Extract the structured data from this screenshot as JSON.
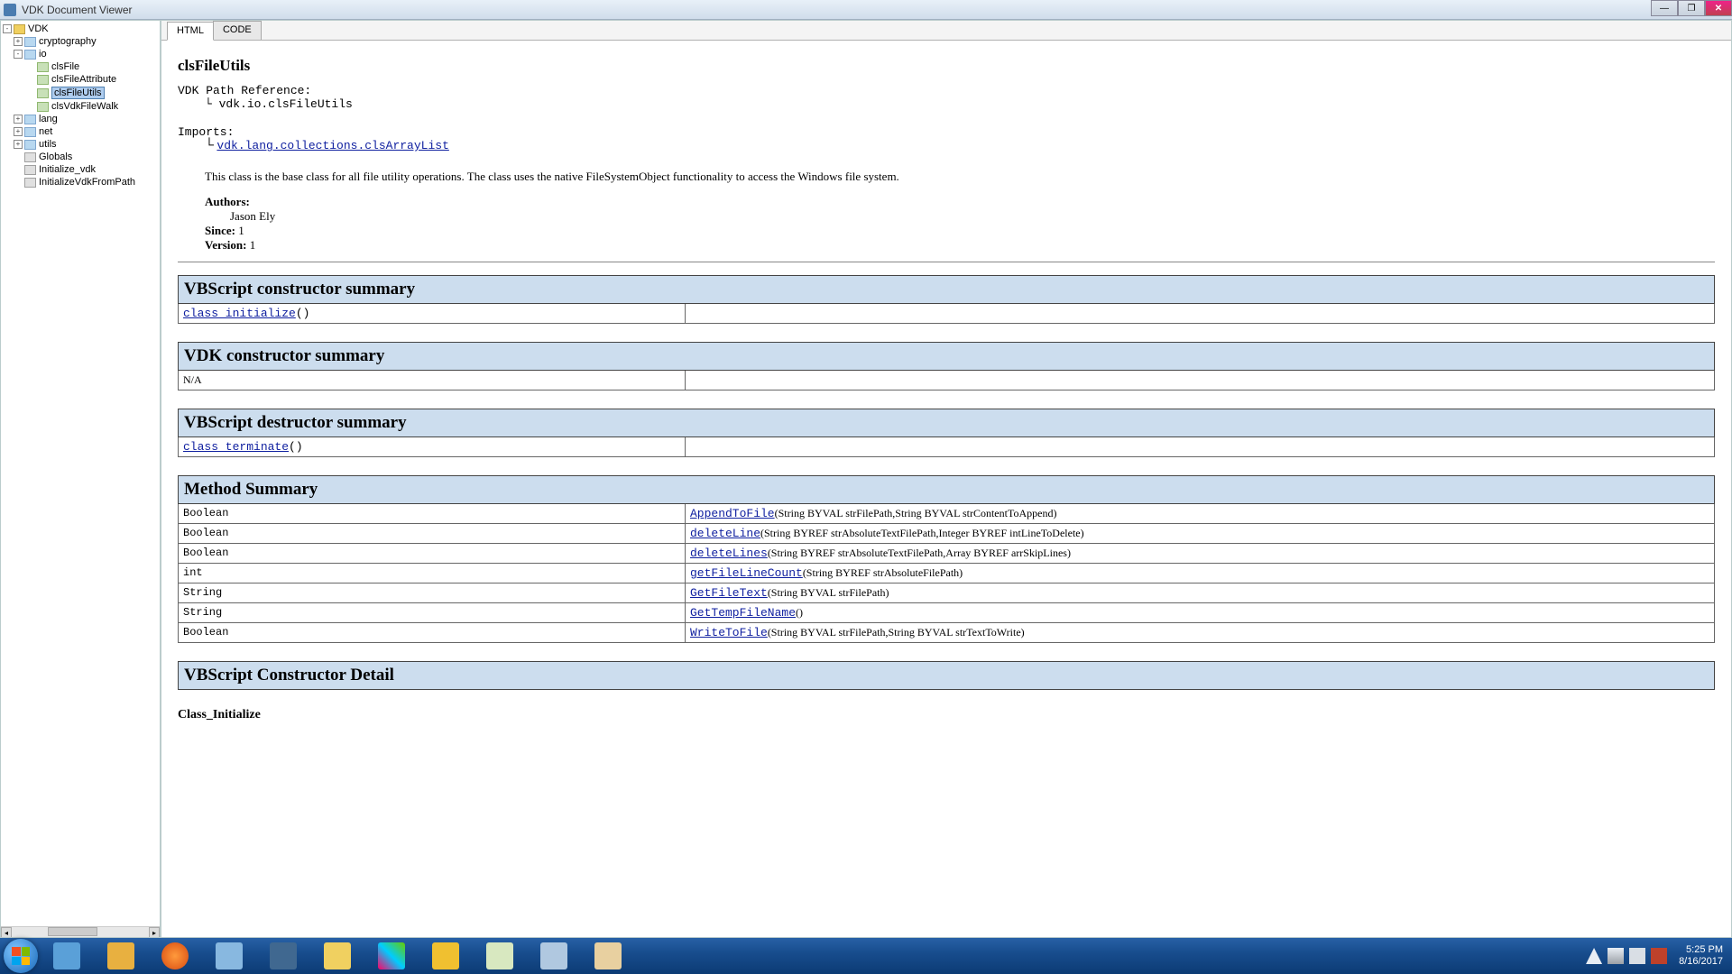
{
  "window": {
    "title": "VDK Document Viewer"
  },
  "tabs": {
    "html": "HTML",
    "code": "CODE"
  },
  "tree": {
    "root": "VDK",
    "cryptography": "cryptography",
    "io": "io",
    "io_children": {
      "clsFile": "clsFile",
      "clsFileAttribute": "clsFileAttribute",
      "clsFileUtils": "clsFileUtils",
      "clsVdkFileWalk": "clsVdkFileWalk"
    },
    "lang": "lang",
    "net": "net",
    "utils": "utils",
    "globals": "Globals",
    "initialize_vdk": "Initialize_vdk",
    "initialize_vdk_from_path": "InitializeVdkFromPath"
  },
  "doc": {
    "class_name": "clsFileUtils",
    "path_ref_label": "VDK Path Reference:",
    "path_ref": "vdk.io.clsFileUtils",
    "imports_label": "Imports:",
    "imports_link": "vdk.lang.collections.clsArrayList",
    "description": "This class is the base class for all file utility operations. The class uses the native FileSystemObject functionality to access the Windows file system.",
    "authors_label": "Authors:",
    "author": "Jason Ely",
    "since_label": "Since:",
    "since_val": "1",
    "version_label": "Version:",
    "version_val": "1",
    "vbs_ctor_title": "VBScript constructor summary",
    "vbs_ctor_link": "class_initialize",
    "vbs_ctor_params": "()",
    "vdk_ctor_title": "VDK constructor summary",
    "vdk_ctor_na": "N/A",
    "vbs_dtor_title": "VBScript destructor summary",
    "vbs_dtor_link": "class_terminate",
    "vbs_dtor_params": "()",
    "method_summary_title": "Method Summary",
    "methods": [
      {
        "ret": "Boolean",
        "name": "AppendToFile",
        "params": "(String BYVAL strFilePath,String BYVAL strContentToAppend)"
      },
      {
        "ret": "Boolean",
        "name": "deleteLine",
        "params": "(String BYREF strAbsoluteTextFilePath,Integer BYREF intLineToDelete)"
      },
      {
        "ret": "Boolean",
        "name": "deleteLines",
        "params": "(String BYREF strAbsoluteTextFilePath,Array BYREF arrSkipLines)"
      },
      {
        "ret": "int",
        "name": "getFileLineCount",
        "params": "(String BYREF strAbsoluteFilePath)"
      },
      {
        "ret": "String",
        "name": "GetFileText",
        "params": "(String BYVAL strFilePath)"
      },
      {
        "ret": "String",
        "name": "GetTempFileName",
        "params": "()"
      },
      {
        "ret": "Boolean",
        "name": "WriteToFile",
        "params": "(String BYVAL strFilePath,String BYVAL strTextToWrite)"
      }
    ],
    "ctor_detail_title": "VBScript Constructor Detail",
    "ctor_detail_name": "Class_Initialize"
  },
  "taskbar": {
    "time": "5:25 PM",
    "date": "8/16/2017"
  }
}
